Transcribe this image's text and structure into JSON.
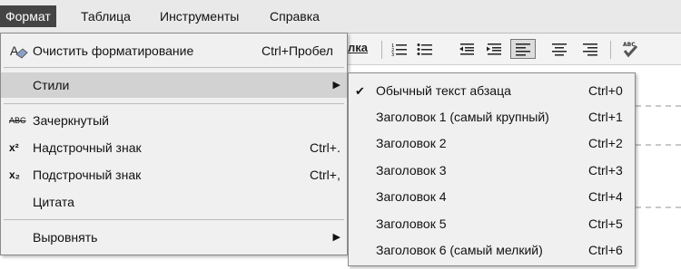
{
  "menubar": {
    "items": [
      {
        "label": "Формат"
      },
      {
        "label": "Таблица"
      },
      {
        "label": "Инструменты"
      },
      {
        "label": "Справка"
      }
    ]
  },
  "toolbar": {
    "link_fragment": "лка"
  },
  "format_menu": {
    "items": [
      {
        "label": "Очистить форматирование",
        "shortcut": "Ctrl+Пробел"
      },
      {
        "label": "Стили"
      },
      {
        "label": "Зачеркнутый",
        "icon_text": "ABC"
      },
      {
        "label": "Надстрочный знак",
        "shortcut": "Ctrl+.",
        "icon_text": "x²"
      },
      {
        "label": "Подстрочный знак",
        "shortcut": "Ctrl+,",
        "icon_text": "x₂"
      },
      {
        "label": "Цитата"
      },
      {
        "label": "Выровнять"
      }
    ]
  },
  "styles_submenu": {
    "items": [
      {
        "label": "Обычный текст абзаца",
        "shortcut": "Ctrl+0",
        "checked": true
      },
      {
        "label": "Заголовок 1 (самый крупный)",
        "shortcut": "Ctrl+1"
      },
      {
        "label": "Заголовок 2",
        "shortcut": "Ctrl+2"
      },
      {
        "label": "Заголовок 3",
        "shortcut": "Ctrl+3"
      },
      {
        "label": "Заголовок 4",
        "shortcut": "Ctrl+4"
      },
      {
        "label": "Заголовок 5",
        "shortcut": "Ctrl+5"
      },
      {
        "label": "Заголовок 6 (самый мелкий)",
        "shortcut": "Ctrl+6"
      }
    ]
  },
  "colors": {
    "active_menu_bg": "#444444",
    "hover_bg": "#d2d2d2",
    "menu_bg": "#f0f0f0"
  }
}
